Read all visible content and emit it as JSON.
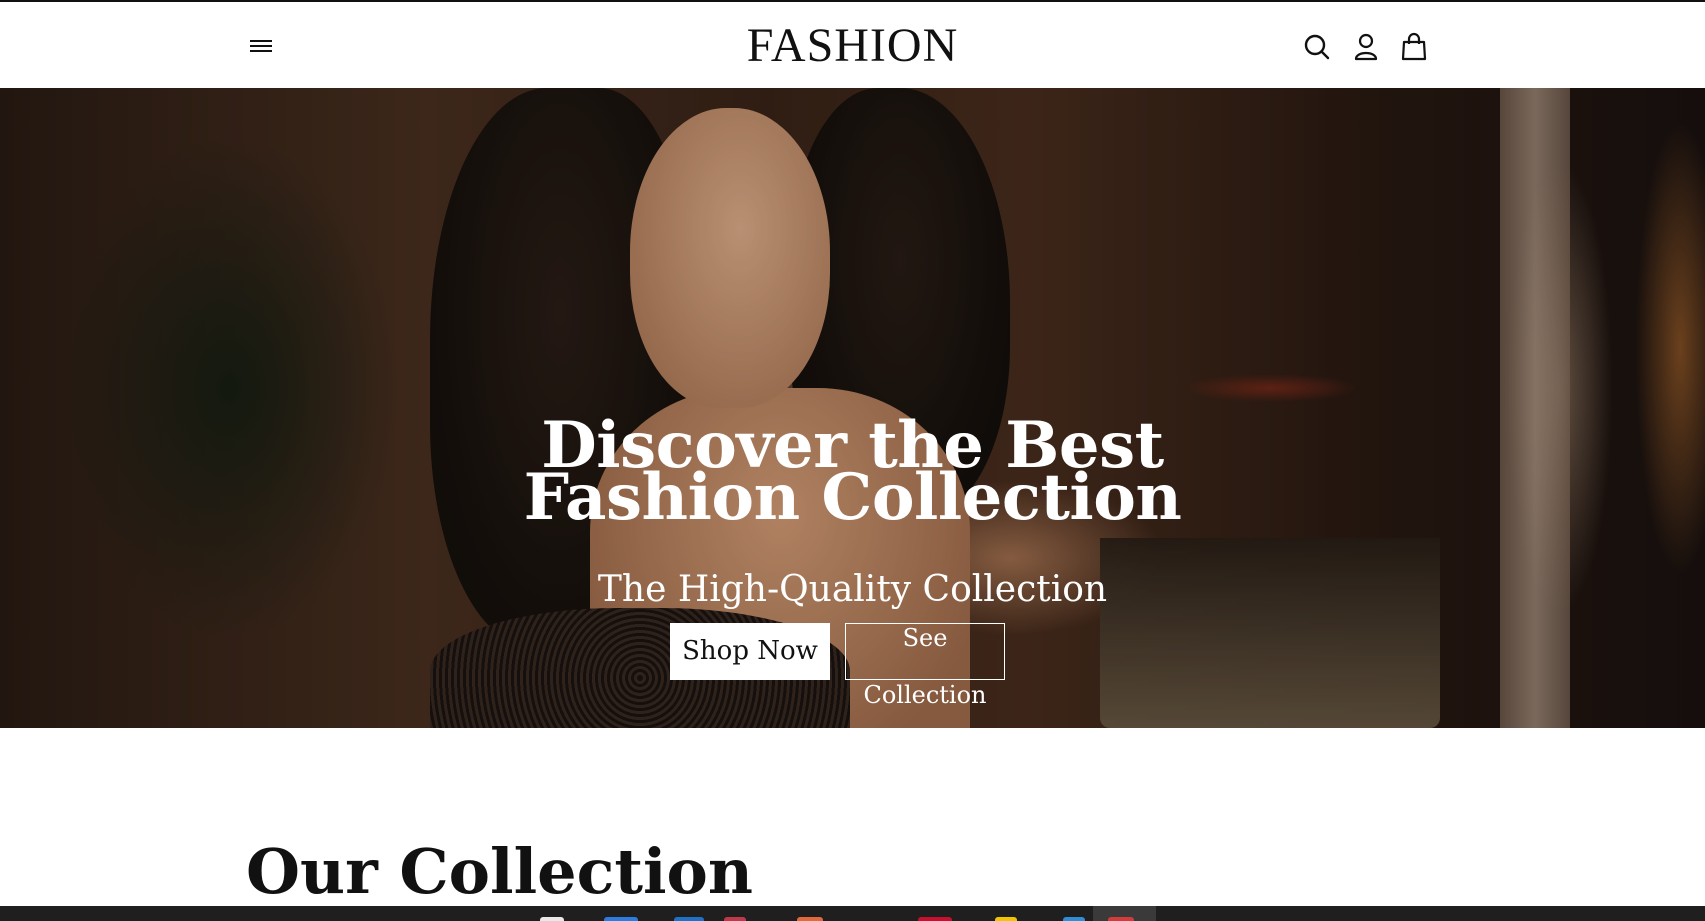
{
  "header": {
    "brand": "FASHION",
    "icons": {
      "menu": "hamburger-icon",
      "search": "search-icon",
      "account": "user-icon",
      "cart": "shopping-bag-icon"
    }
  },
  "hero": {
    "title_line1": "Discover the Best",
    "title_line2": "Fashion Collection",
    "subtitle": "The High-Quality Collection",
    "shop_button_label": "Shop Now",
    "see_button_label": "See Collection"
  },
  "collection": {
    "heading": "Our Collection"
  },
  "taskbar": {
    "icons": [
      {
        "name": "chrome-icon",
        "color": "#e8e8e8"
      },
      {
        "name": "files-icon",
        "color": "#2b7de0"
      },
      {
        "name": "edge-icon",
        "color": "#1e73c8"
      },
      {
        "name": "app-icon",
        "color": "#c0394b"
      },
      {
        "name": "browser-icon",
        "color": "#e06a3c"
      },
      {
        "name": "calendar-icon",
        "color": "#c8102e"
      },
      {
        "name": "photos-icon",
        "color": "#f2c500"
      },
      {
        "name": "vscode-icon",
        "color": "#2d8fd8"
      },
      {
        "name": "active-app-icon",
        "color": "#d23c3c"
      }
    ]
  }
}
